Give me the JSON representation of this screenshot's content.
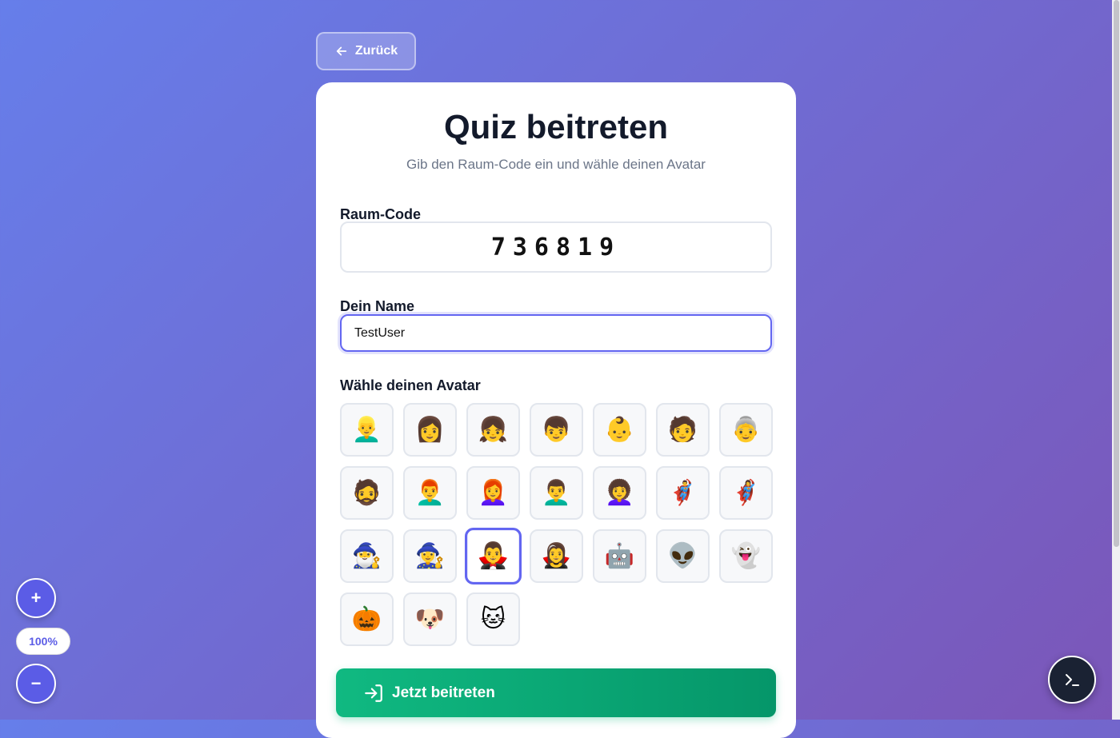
{
  "nav": {
    "back_label": "Zurück",
    "back_icon": "arrow-left-icon"
  },
  "card": {
    "title": "Quiz beitreten",
    "subtitle": "Gib den Raum-Code ein und wähle deinen Avatar"
  },
  "room_code": {
    "label": "Raum-Code",
    "value": "736819"
  },
  "name": {
    "label": "Dein Name",
    "value": "TestUser"
  },
  "avatar": {
    "label": "Wähle deinen Avatar",
    "selected_index": 16,
    "items": [
      {
        "emoji": "👱‍♂️",
        "name": "avatar-blond-man"
      },
      {
        "emoji": "👩",
        "name": "avatar-woman"
      },
      {
        "emoji": "👧",
        "name": "avatar-girl"
      },
      {
        "emoji": "👦",
        "name": "avatar-boy"
      },
      {
        "emoji": "👶",
        "name": "avatar-baby"
      },
      {
        "emoji": "🧑",
        "name": "avatar-person"
      },
      {
        "emoji": "👵",
        "name": "avatar-old-woman"
      },
      {
        "emoji": "🧔",
        "name": "avatar-bearded-man"
      },
      {
        "emoji": "👨‍🦰",
        "name": "avatar-red-haired-man"
      },
      {
        "emoji": "👩‍🦰",
        "name": "avatar-red-haired-woman"
      },
      {
        "emoji": "👨‍🦱",
        "name": "avatar-curly-man"
      },
      {
        "emoji": "👩‍🦱",
        "name": "avatar-curly-woman"
      },
      {
        "emoji": "🦸‍♂️",
        "name": "avatar-superhero-man"
      },
      {
        "emoji": "🦸‍♀️",
        "name": "avatar-superhero-woman"
      },
      {
        "emoji": "🧙‍♂️",
        "name": "avatar-wizard"
      },
      {
        "emoji": "🧙‍♀️",
        "name": "avatar-witch"
      },
      {
        "emoji": "🧛‍♂️",
        "name": "avatar-vampire-man"
      },
      {
        "emoji": "🧛‍♀️",
        "name": "avatar-vampire-woman"
      },
      {
        "emoji": "🤖",
        "name": "avatar-robot"
      },
      {
        "emoji": "👽",
        "name": "avatar-alien"
      },
      {
        "emoji": "👻",
        "name": "avatar-ghost"
      },
      {
        "emoji": "🎃",
        "name": "avatar-pumpkin"
      },
      {
        "emoji": "🐶",
        "name": "avatar-dog"
      },
      {
        "emoji": "🐱",
        "name": "avatar-cat"
      }
    ]
  },
  "join_button": {
    "label": "Jetzt beitreten",
    "icon": "login-icon"
  },
  "zoom": {
    "in_label": "+",
    "out_label": "−",
    "level": "100%"
  },
  "terminal": {
    "icon": "terminal-icon"
  },
  "colors": {
    "accent": "#6366f1",
    "join_green": "#10b981",
    "title": "#131a2b"
  }
}
